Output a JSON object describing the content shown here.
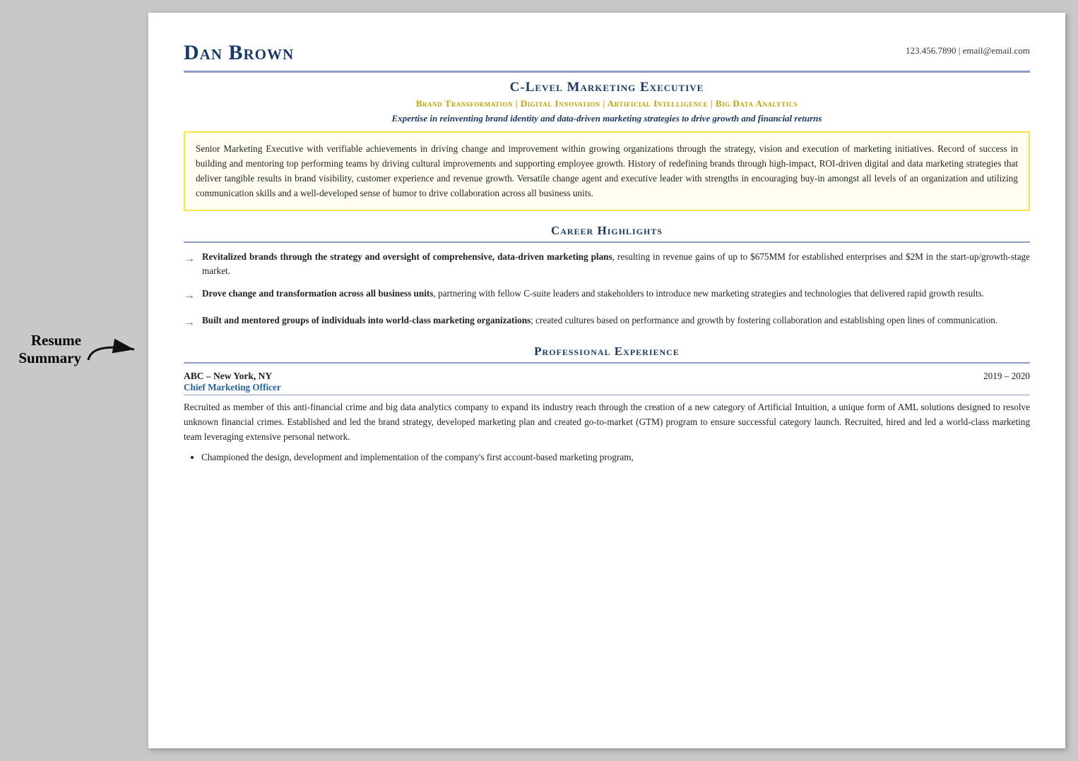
{
  "annotation": {
    "label_line1": "Resume",
    "label_line2": "Summary"
  },
  "header": {
    "name": "Dan Brown",
    "contact": "123.456.7890  |  email@email.com"
  },
  "title": {
    "job_title": "C-Level Marketing Executive",
    "specialties": "Brand Transformation  |  Digital Innovation  |  Artificial Intelligence  |  Big Data Analytics",
    "tagline": "Expertise in reinventing brand identity and data-driven marketing strategies to drive growth and financial returns"
  },
  "summary": {
    "text": "Senior Marketing Executive with verifiable achievements in driving change and improvement within growing organizations through the strategy, vision and execution of marketing initiatives. Record of success in building and mentoring top performing teams by driving cultural improvements and supporting employee growth. History of redefining brands through high-impact, ROI-driven digital and data marketing strategies that deliver tangible results in brand visibility, customer experience and revenue growth. Versatile change agent and executive leader with strengths in encouraging buy-in amongst all levels of an organization and utilizing communication skills and a well-developed sense of humor to drive collaboration across all business units."
  },
  "career_highlights": {
    "section_title": "Career Highlights",
    "items": [
      {
        "bold": "Revitalized brands through the strategy and oversight of comprehensive, data-driven marketing plans",
        "rest": ", resulting in revenue gains of up to $675MM for established enterprises and $2M in the start-up/growth-stage market."
      },
      {
        "bold": "Drove change and transformation across all business units",
        "rest": ", partnering with fellow C-suite leaders and stakeholders to introduce new marketing strategies and technologies that delivered rapid growth results."
      },
      {
        "bold": "Built and mentored groups of individuals into world-class marketing organizations",
        "rest": "; created cultures based on performance and growth by fostering collaboration and establishing open lines of communication."
      }
    ]
  },
  "professional_experience": {
    "section_title": "Professional Experience",
    "jobs": [
      {
        "company": "ABC",
        "location": "New York, NY",
        "dates": "2019 – 2020",
        "role": "Chief Marketing Officer",
        "description": "Recruited as member of this anti-financial crime and big data analytics company to expand its industry reach through the creation of a new category of Artificial Intuition, a unique form of AML solutions designed to resolve unknown financial crimes. Established and led the brand strategy, developed marketing plan and created go-to-market (GTM) program to ensure successful category launch. Recruited, hired and led a world-class marketing team leveraging extensive personal network.",
        "bullets": [
          "Championed the design, development and implementation of the company's first account-based marketing program,"
        ]
      }
    ]
  }
}
